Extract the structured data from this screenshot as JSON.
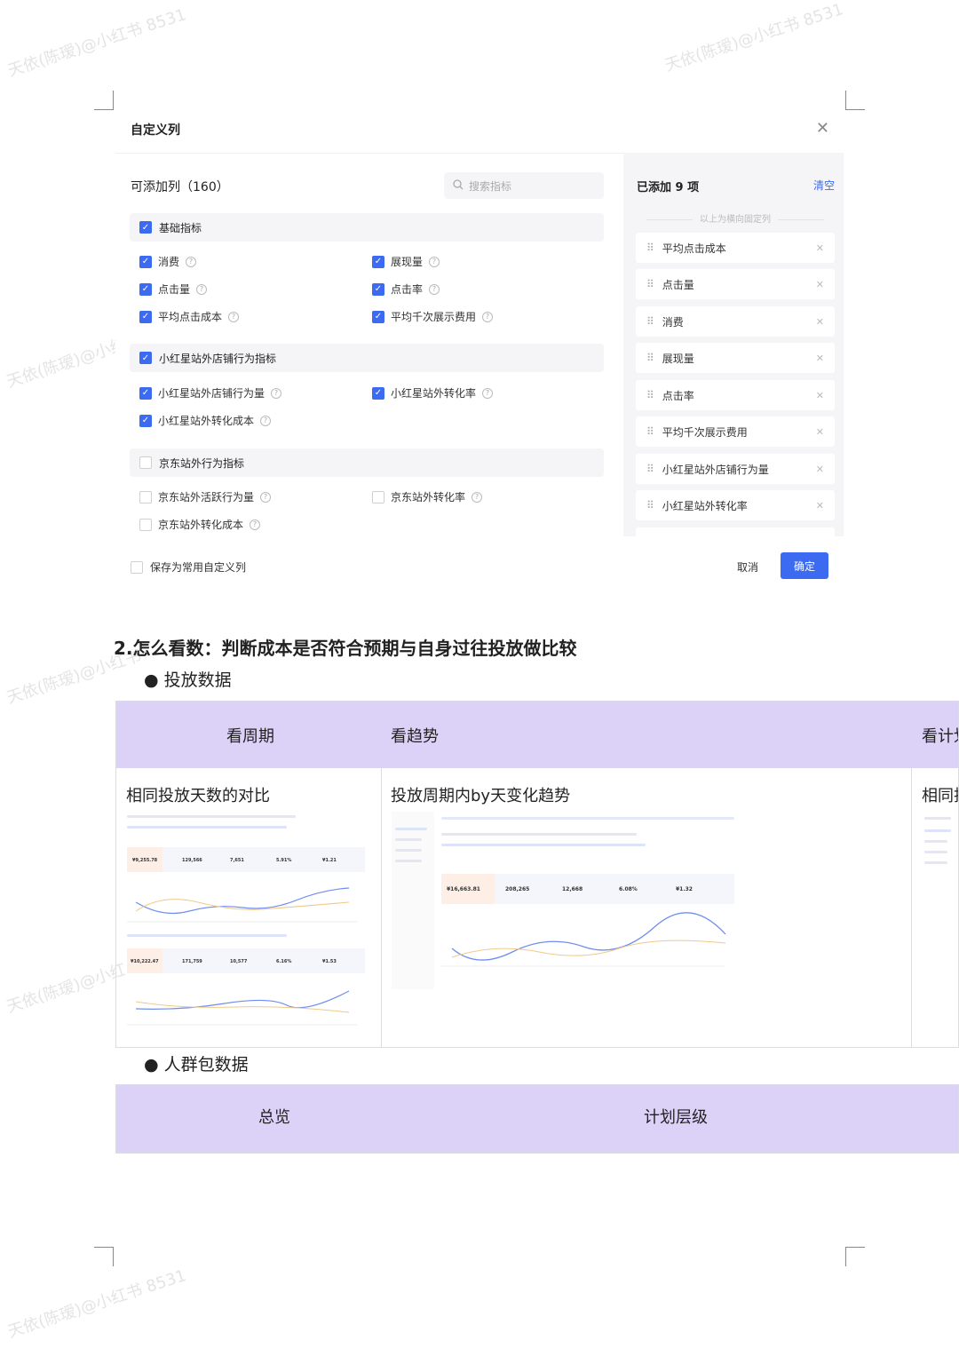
{
  "watermarks": [
    "天依(陈瑷)@小红书 8531",
    "天依(陈瑷)@小红书 8531",
    "天依(陈瑷)@小红书",
    "天依(陈瑷)@小红书",
    "天依(陈瑷)@小红书",
    "天依(陈瑷)@小红书 8531"
  ],
  "dialog": {
    "title": "自定义列",
    "available_title": "可添加列（160）",
    "search_placeholder": "搜索指标",
    "groups": [
      {
        "label": "基础指标",
        "checked": true,
        "options": [
          {
            "label": "消费",
            "checked": true
          },
          {
            "label": "展现量",
            "checked": true
          },
          {
            "label": "点击量",
            "checked": true
          },
          {
            "label": "点击率",
            "checked": true
          },
          {
            "label": "平均点击成本",
            "checked": true
          },
          {
            "label": "平均千次展示费用",
            "checked": true
          }
        ]
      },
      {
        "label": "小红星站外店铺行为指标",
        "checked": true,
        "options": [
          {
            "label": "小红星站外店铺行为量",
            "checked": true
          },
          {
            "label": "小红星站外转化率",
            "checked": true
          },
          {
            "label": "小红星站外转化成本",
            "checked": true
          }
        ]
      },
      {
        "label": "京东站外行为指标",
        "checked": false,
        "options": [
          {
            "label": "京东站外活跃行为量",
            "checked": false
          },
          {
            "label": "京东站外转化率",
            "checked": false
          },
          {
            "label": "京东站外转化成本",
            "checked": false
          }
        ]
      }
    ],
    "selected_title": "已添加 9 项",
    "clear_label": "清空",
    "fixed_hint": "以上为横向固定列",
    "selected_items": [
      "平均点击成本",
      "点击量",
      "消费",
      "展现量",
      "点击率",
      "平均千次展示费用",
      "小红星站外店铺行为量",
      "小红星站外转化率"
    ],
    "save_label": "保存为常用自定义列",
    "cancel_label": "取消",
    "ok_label": "确定"
  },
  "doc": {
    "heading": "2.怎么看数：判断成本是否符合预期与自身过往投放做比较",
    "bullet1": "● 投放数据",
    "bullet2": "● 人群包数据",
    "table1": {
      "headers": [
        "看周期",
        "看趋势",
        "看计划"
      ],
      "cells": [
        "相同投放天数的对比",
        "投放周期内by天变化趋势",
        "相同投"
      ]
    },
    "table2": {
      "headers": [
        "总览",
        "计划层级"
      ]
    },
    "thumb_a": {
      "stats1": [
        "¥9,255.78",
        "129,566",
        "7,651",
        "5.91%",
        "¥1.21"
      ],
      "stats2": [
        "¥10,222.47",
        "171,759",
        "10,577",
        "6.16%",
        "¥1.53"
      ]
    },
    "thumb_b": {
      "stats": [
        "¥16,663.81",
        "208,265",
        "12,668",
        "6.08%",
        "¥1.32"
      ]
    }
  },
  "colors": {
    "accent": "#3c6af0",
    "table_header": "#dcd1f7"
  }
}
